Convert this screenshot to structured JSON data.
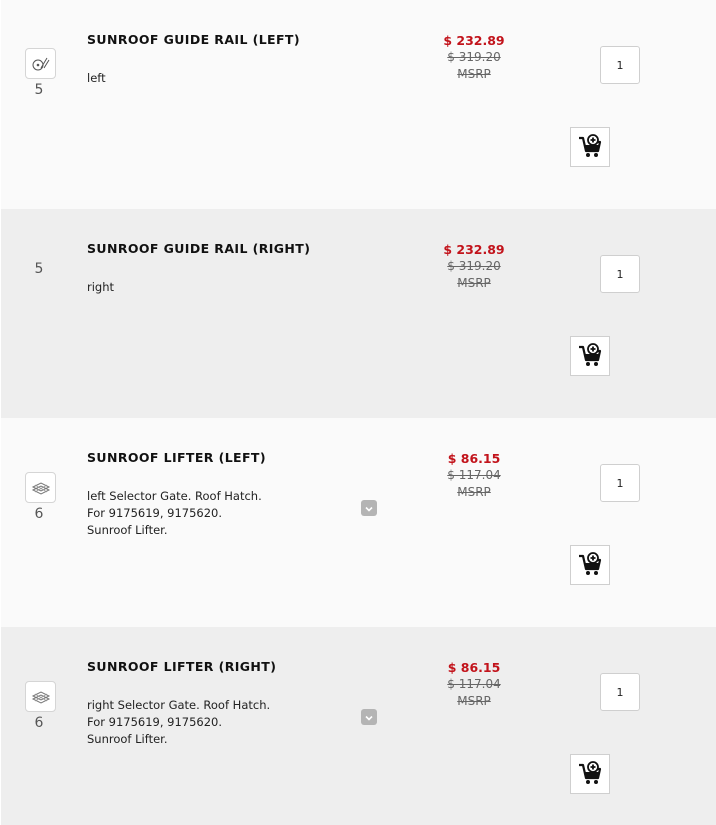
{
  "items": [
    {
      "ref": "5",
      "has_thumb": true,
      "thumb_icon": "sunroof-rail-diagram-icon",
      "title": "SUNROOF GUIDE RAIL (LEFT)",
      "description": [
        "left"
      ],
      "price": "$ 232.89",
      "msrp": "$ 319.20",
      "msrp_label": "MSRP",
      "quantity": "1",
      "has_expand": false
    },
    {
      "ref": "5",
      "has_thumb": false,
      "title": "SUNROOF GUIDE RAIL (RIGHT)",
      "description": [
        "right"
      ],
      "price": "$ 232.89",
      "msrp": "$ 319.20",
      "msrp_label": "MSRP",
      "quantity": "1",
      "has_expand": false
    },
    {
      "ref": "6",
      "has_thumb": true,
      "thumb_icon": "sunroof-lifter-diagram-icon",
      "title": "SUNROOF LIFTER (LEFT)",
      "description": [
        "left Selector Gate. Roof Hatch.",
        "For 9175619, 9175620.",
        "Sunroof Lifter."
      ],
      "price": "$ 86.15",
      "msrp": "$ 117.04",
      "msrp_label": "MSRP",
      "quantity": "1",
      "has_expand": true
    },
    {
      "ref": "6",
      "has_thumb": true,
      "thumb_icon": "sunroof-lifter-diagram-icon",
      "title": "SUNROOF LIFTER (RIGHT)",
      "description": [
        "right Selector Gate. Roof Hatch.",
        "For 9175619, 9175620.",
        "Sunroof Lifter."
      ],
      "price": "$ 86.15",
      "msrp": "$ 117.04",
      "msrp_label": "MSRP",
      "quantity": "1",
      "has_expand": true
    }
  ],
  "colors": {
    "sale_price": "#c2131b",
    "row_alt": "#eeeeee",
    "row": "#fafafa"
  },
  "icons": {
    "add_to_cart": "cart-plus-icon",
    "expand": "chevron-down-icon"
  }
}
